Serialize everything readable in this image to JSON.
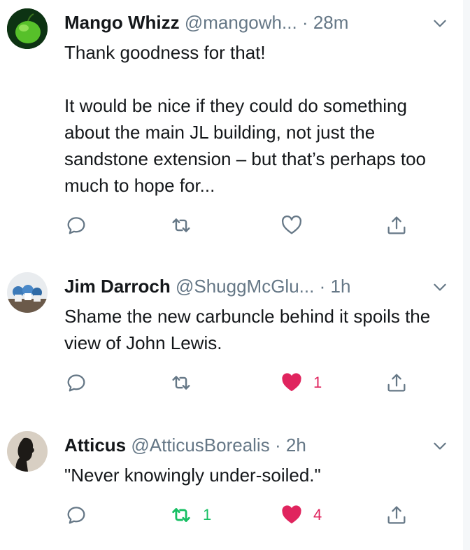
{
  "tweets": [
    {
      "name": "Mango Whizz",
      "handle": "@mangowh...",
      "separator": "·",
      "time": "28m",
      "text": "Thank goodness for that!\n\nIt would be nice if they could do something about the main JL building, not just the sandstone extension – but that’s perhaps too much to hope for...",
      "retweets": "",
      "likes": "",
      "retweeted": false,
      "liked": false
    },
    {
      "name": "Jim Darroch",
      "handle": "@ShuggMcGlu...",
      "separator": "·",
      "time": "1h",
      "text": "Shame the new carbuncle behind it spoils the view of John Lewis.",
      "retweets": "",
      "likes": "1",
      "retweeted": false,
      "liked": true
    },
    {
      "name": "Atticus",
      "handle": "@AtticusBorealis",
      "separator": "·",
      "time": "2h",
      "text": "\"Never knowingly under-soiled.\"",
      "retweets": "1",
      "likes": "4",
      "retweeted": true,
      "liked": true
    }
  ],
  "colors": {
    "like": "#e0245e",
    "retweet": "#17bf63",
    "muted": "#657786",
    "text": "#14171a"
  },
  "icons": [
    "reply-icon",
    "retweet-icon",
    "like-icon",
    "share-icon",
    "chevron-down-icon"
  ]
}
